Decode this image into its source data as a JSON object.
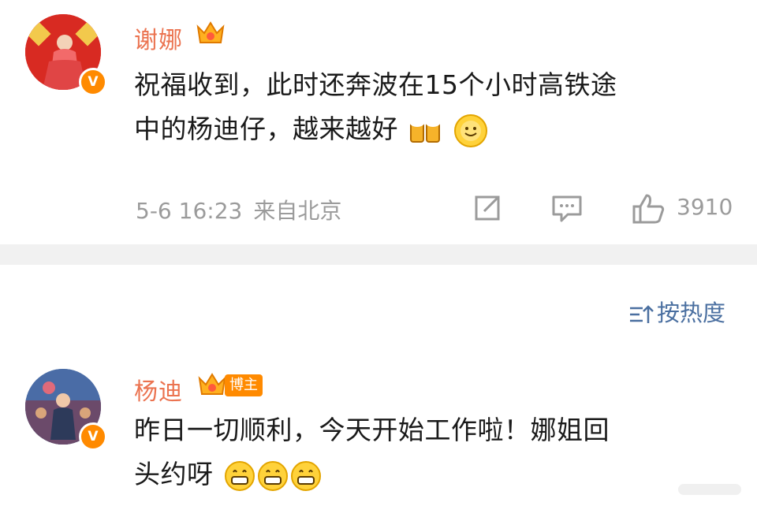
{
  "post": {
    "author": "谢娜",
    "content_line1": "祝福收到，此时还奔波在15个小时高铁途",
    "content_line2": "中的杨迪仔，越来越好",
    "timestamp": "5-6 16:23",
    "source": "来自北京",
    "like_count": "3910",
    "icons": [
      "share-icon",
      "comment-icon",
      "like-icon"
    ],
    "emojis": [
      "cheers-emoji",
      "smile-sun-emoji"
    ]
  },
  "sort": {
    "label": "按热度"
  },
  "reply": {
    "author": "杨迪",
    "badge": "博主",
    "content_line1": "昨日一切顺利，今天开始工作啦！娜姐回",
    "content_line2": "头约呀",
    "emojis": [
      "grin-emoji",
      "grin-emoji",
      "grin-emoji"
    ]
  },
  "colors": {
    "username": "#eb7350",
    "meta": "#9b9b9b",
    "link": "#4a6fa0",
    "badge": "#ff8a00",
    "divider": "#f1f1f1"
  }
}
